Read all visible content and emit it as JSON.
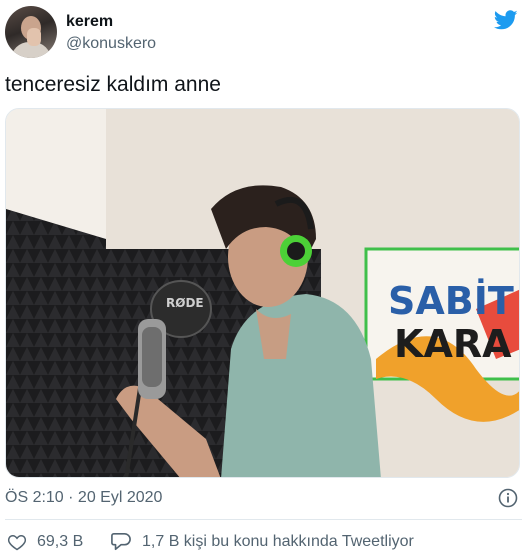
{
  "tweet": {
    "author_name": "kerem",
    "author_handle": "@konuskero",
    "text": "tenceresiz kaldım anne",
    "timestamp": "ÖS 2:10 · 20 Eyl 2020",
    "media_wall_text_line1": "SABİT",
    "media_wall_text_line2": "KARA"
  },
  "actions": {
    "likes": "69,3 B",
    "conversation": "1,7 B kişi bu konu hakkında Tweetliyor"
  },
  "icons": {
    "brand": "twitter-bird-icon",
    "info": "info-icon",
    "like": "heart-icon",
    "reply": "speech-bubble-icon"
  },
  "colors": {
    "brand_blue": "#1d9bf0",
    "secondary_text": "#536471",
    "headphone_green": "#4cd137"
  }
}
